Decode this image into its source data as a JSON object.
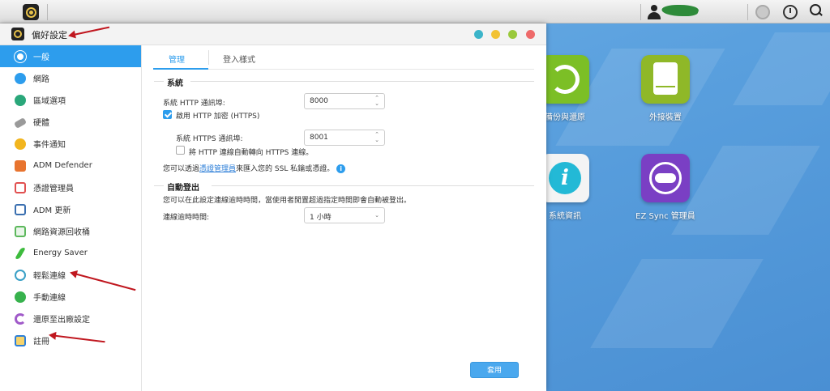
{
  "window": {
    "title": "偏好設定",
    "controls": [
      "minimize",
      "restore",
      "maximize",
      "close"
    ],
    "control_colors": [
      "#3bb4c9",
      "#f2c233",
      "#9ac93b",
      "#ee6a6a"
    ]
  },
  "sidebar": {
    "items": [
      {
        "label": "一般",
        "icon": "general-icon",
        "color": "#ffffff",
        "active": true
      },
      {
        "label": "網路",
        "icon": "globe-icon",
        "color": "#2d9ded"
      },
      {
        "label": "區域選項",
        "icon": "region-icon",
        "color": "#2aa77a"
      },
      {
        "label": "硬體",
        "icon": "hardware-icon",
        "color": "#8a8a8a"
      },
      {
        "label": "事件通知",
        "icon": "alert-icon",
        "color": "#f2b51e"
      },
      {
        "label": "ADM Defender",
        "icon": "defender-icon",
        "color": "#e8742f"
      },
      {
        "label": "憑證管理員",
        "icon": "certificate-icon",
        "color": "#e15050"
      },
      {
        "label": "ADM 更新",
        "icon": "update-icon",
        "color": "#3a6fb0"
      },
      {
        "label": "網路資源回收桶",
        "icon": "recycle-bin-icon",
        "color": "#5cb85c"
      },
      {
        "label": "Energy Saver",
        "icon": "energy-icon",
        "color": "#3dbb3d"
      },
      {
        "label": "輕鬆連線",
        "icon": "cloud-connect-icon",
        "color": "#3aa0c6"
      },
      {
        "label": "手動連線",
        "icon": "manual-connect-icon",
        "color": "#37b24d"
      },
      {
        "label": "還原至出廠設定",
        "icon": "restore-icon",
        "color": "#a05ac9"
      },
      {
        "label": "註冊",
        "icon": "register-icon",
        "color": "#2d7fd8"
      }
    ]
  },
  "tabs": [
    {
      "label": "管理",
      "active": true
    },
    {
      "label": "登入樣式",
      "active": false
    }
  ],
  "system": {
    "section_title": "系統",
    "http_port_label": "系統 HTTP 通訊埠:",
    "http_port_value": "8000",
    "enable_https_label": "啟用 HTTP 加密 (HTTPS)",
    "enable_https_checked": true,
    "https_port_label": "系統 HTTPS 通訊埠:",
    "https_port_value": "8001",
    "redirect_label": "將 HTTP 連線自動轉向 HTTPS 連線。",
    "redirect_checked": false,
    "ssl_note_prefix": "您可以透過",
    "ssl_note_link": "憑證管理員",
    "ssl_note_suffix": "來匯入您的 SSL 私鑰或憑證。"
  },
  "auto_logout": {
    "section_title": "自動登出",
    "description": "您可以在此設定連線逾時時間，當使用者閒置超過指定時間即會自動被登出。",
    "timeout_label": "連線逾時時間:",
    "timeout_value": "1 小時"
  },
  "apply_label": "套用",
  "desktop": {
    "icons": [
      {
        "label": "備份與還原",
        "color": "#7cbf26",
        "icon": "backup-restore-icon"
      },
      {
        "label": "外接裝置",
        "color": "#8fb828",
        "icon": "external-device-icon"
      },
      {
        "label": "系統資訊",
        "color": "#f4f4f4",
        "icon": "system-info-icon"
      },
      {
        "label": "EZ Sync 管理員",
        "color": "#7a3fc4",
        "icon": "ez-sync-icon"
      }
    ]
  },
  "annotation_color": "#c0171f"
}
